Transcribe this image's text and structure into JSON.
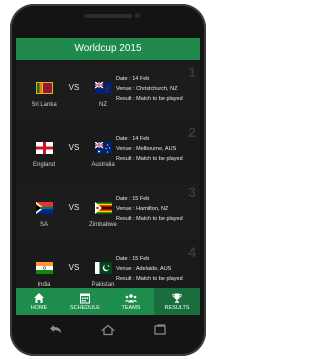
{
  "app": {
    "title": "Worldcup 2015"
  },
  "matches": [
    {
      "number": "1",
      "team_a": "Sri Lanka",
      "team_b": "NZ",
      "vs": "VS",
      "date": "Date : 14 Feb",
      "venue": "Venue : Christchurch, NZ",
      "result": "Result : Match to be played"
    },
    {
      "number": "2",
      "team_a": "England",
      "team_b": "Australia",
      "vs": "VS",
      "date": "Date : 14 Feb",
      "venue": "Venue : Melbourne, AUS",
      "result": "Result : Match to be played"
    },
    {
      "number": "3",
      "team_a": "SA",
      "team_b": "Zimbabwe",
      "vs": "VS",
      "date": "Date : 15 Feb",
      "venue": "Venue : Hamilton, NZ",
      "result": "Result : Match to be played"
    },
    {
      "number": "4",
      "team_a": "India",
      "team_b": "Pakistan",
      "vs": "VS",
      "date": "Date : 15 Feb",
      "venue": "Venue : Adelaide, AUS",
      "result": "Result : Match to be played"
    }
  ],
  "nav": {
    "home": "HOME",
    "schedule": "SCHEDULE",
    "teams": "TEAMS",
    "results": "RESULTS",
    "active": "results"
  },
  "colors": {
    "accent": "#1f8a4c",
    "active_tab": "#186f3d",
    "card_bg": "#1a1a1a"
  },
  "icons": [
    "home-icon",
    "calendar-icon",
    "people-icon",
    "trophy-icon",
    "back-icon",
    "home-key-icon",
    "recents-icon"
  ]
}
